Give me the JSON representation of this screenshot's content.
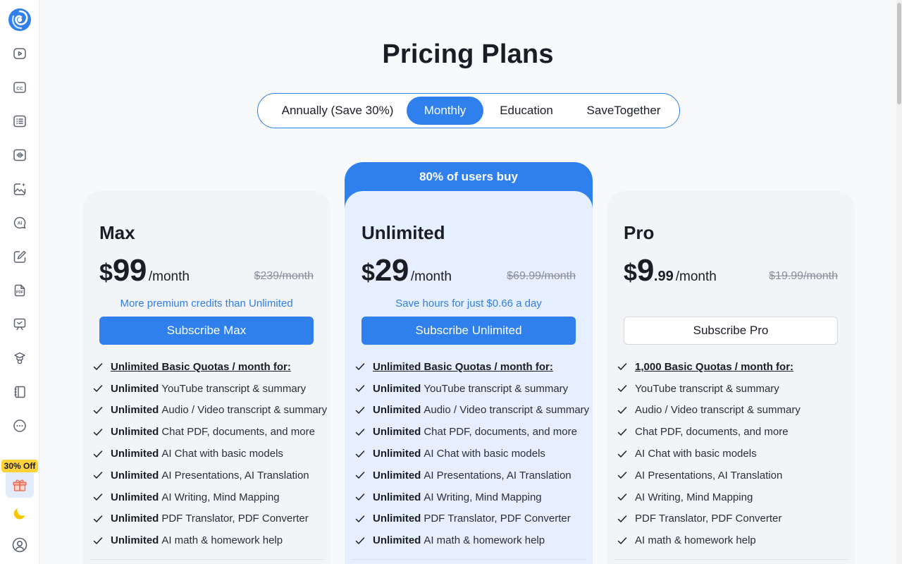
{
  "sidebar": {
    "items": [
      {
        "icon": "youtube-icon"
      },
      {
        "icon": "captions-icon"
      },
      {
        "icon": "list-icon"
      },
      {
        "icon": "audio-wave-icon"
      },
      {
        "icon": "image-sparkle-icon"
      },
      {
        "icon": "ai-chat-icon"
      },
      {
        "icon": "pen-write-icon"
      },
      {
        "icon": "pdf-icon"
      },
      {
        "icon": "presentation-icon"
      },
      {
        "icon": "graduation-icon"
      },
      {
        "icon": "notebook-icon"
      },
      {
        "icon": "more-icon"
      }
    ],
    "promo_badge": "30% Off",
    "accent": "#2f80ed"
  },
  "page": {
    "title": "Pricing Plans"
  },
  "billing_toggle": {
    "options": [
      "Annually (Save 30%)",
      "Monthly",
      "Education",
      "SaveTogether"
    ],
    "selected": "Monthly"
  },
  "plans": [
    {
      "name": "Max",
      "currency": "$",
      "amount": "99",
      "cents": "",
      "per": "/month",
      "old_price": "$239/month",
      "promo": "More premium credits than Unlimited",
      "cta": "Subscribe Max",
      "features_head": "Unlimited Basic Quotas / month for:",
      "features": [
        {
          "bold": "Unlimited",
          "text": "YouTube transcript & summary"
        },
        {
          "bold": "Unlimited",
          "text": "Audio / Video transcript & summary"
        },
        {
          "bold": "Unlimited",
          "text": "Chat PDF, documents, and more"
        },
        {
          "bold": "Unlimited",
          "text": "AI Chat with basic models"
        },
        {
          "bold": "Unlimited",
          "text": "AI Presentations, AI Translation"
        },
        {
          "bold": "Unlimited",
          "text": "AI Writing, Mind Mapping"
        },
        {
          "bold": "Unlimited",
          "text": "PDF Translator, PDF Converter"
        },
        {
          "bold": "Unlimited",
          "text": "AI math & homework help"
        }
      ]
    },
    {
      "name": "Unlimited",
      "ribbon": "80% of users buy",
      "currency": "$",
      "amount": "29",
      "cents": "",
      "per": "/month",
      "old_price": "$69.99/month",
      "promo": "Save hours for just $0.66 a day",
      "cta": "Subscribe Unlimited",
      "features_head": "Unlimited Basic Quotas / month for:",
      "features": [
        {
          "bold": "Unlimited",
          "text": "YouTube transcript & summary"
        },
        {
          "bold": "Unlimited",
          "text": "Audio / Video transcript & summary"
        },
        {
          "bold": "Unlimited",
          "text": "Chat PDF, documents, and more"
        },
        {
          "bold": "Unlimited",
          "text": "AI Chat with basic models"
        },
        {
          "bold": "Unlimited",
          "text": "AI Presentations, AI Translation"
        },
        {
          "bold": "Unlimited",
          "text": "AI Writing, Mind Mapping"
        },
        {
          "bold": "Unlimited",
          "text": "PDF Translator, PDF Converter"
        },
        {
          "bold": "Unlimited",
          "text": "AI math & homework help"
        }
      ]
    },
    {
      "name": "Pro",
      "currency": "$",
      "amount": "9",
      "cents": ".99",
      "per": "/month",
      "old_price": "$19.99/month",
      "promo": "",
      "cta": "Subscribe Pro",
      "features_head": "1,000 Basic Quotas / month for:",
      "features": [
        {
          "bold": "",
          "text": "YouTube transcript & summary"
        },
        {
          "bold": "",
          "text": "Audio / Video transcript & summary"
        },
        {
          "bold": "",
          "text": "Chat PDF, documents, and more"
        },
        {
          "bold": "",
          "text": "AI Chat with basic models"
        },
        {
          "bold": "",
          "text": "AI Presentations, AI Translation"
        },
        {
          "bold": "",
          "text": "AI Writing, Mind Mapping"
        },
        {
          "bold": "",
          "text": "PDF Translator, PDF Converter"
        },
        {
          "bold": "",
          "text": "AI math & homework help"
        }
      ]
    }
  ]
}
